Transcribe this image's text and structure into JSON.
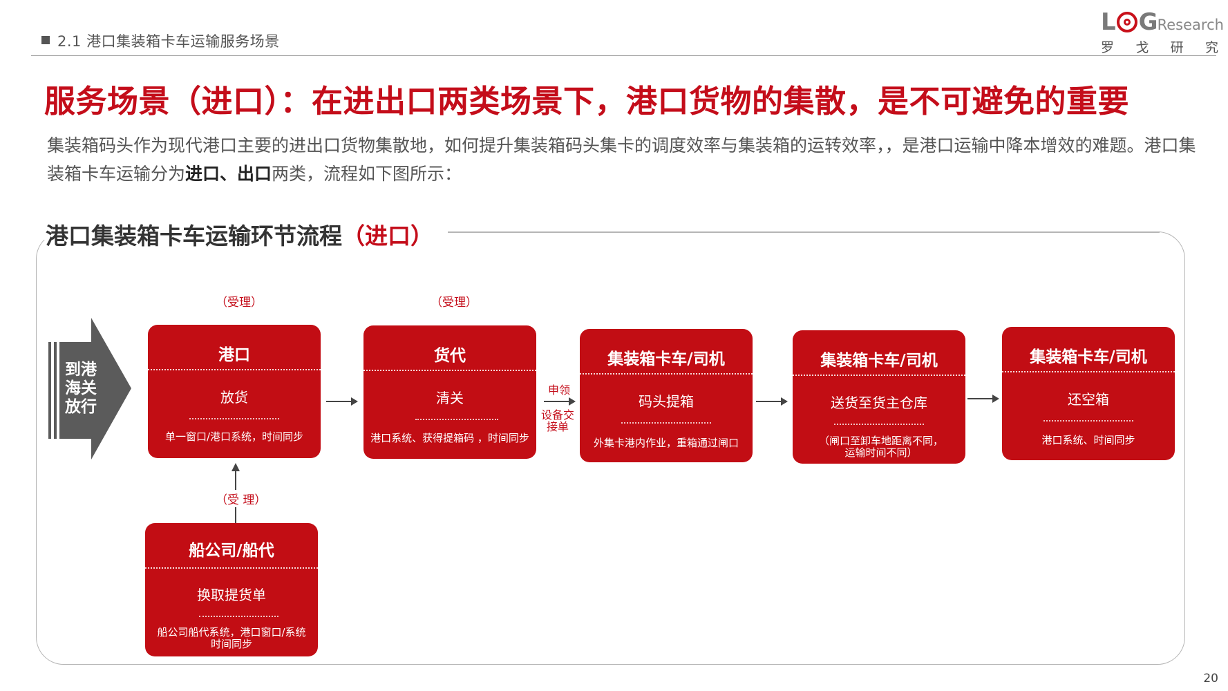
{
  "header": {
    "section": "2.1 港口集装箱卡车运输服务场景",
    "logo": {
      "brand_l": "L",
      "brand_g": "G",
      "brand_rest": "Research",
      "sub": [
        "罗",
        "戈",
        "研",
        "究"
      ]
    }
  },
  "title": "服务场景（进口）：在进出口两类场景下，港口货物的集散，是不可避免的重要",
  "intro": {
    "text1": "集装箱码头作为现代港口主要的进出口货物集散地，如何提升集装箱码头集卡的调度效率与集装箱的运转效率，，是港口运输中降本增效的难题。港口集装箱卡车运输分为",
    "bold": "进口、出口",
    "text2": "两类，流程如下图所示："
  },
  "section_title": {
    "main": "港口集装箱卡车运输环节流程",
    "highlight": "（进口）"
  },
  "flow": {
    "start": {
      "label": "到港海关放行"
    },
    "accept_labels": [
      "（受理）",
      "（受理）",
      "（受 理）"
    ],
    "apply_label": "申领",
    "exchange_label": "设备交接单",
    "boxes": [
      {
        "title": "港口",
        "action": "放货",
        "system": "单一窗口/港口系统，时间同步"
      },
      {
        "title": "货代",
        "action": "清关",
        "system": "港口系统、获得提箱码 ，时间同步"
      },
      {
        "title": "集装箱卡车/司机",
        "action": "码头提箱",
        "system": "外集卡港内作业，重箱通过闸口"
      },
      {
        "title": "集装箱卡车/司机",
        "action": "送货至货主仓库",
        "system": "（闸口至卸车地距离不同，运输时间不同）"
      },
      {
        "title": "集装箱卡车/司机",
        "action": "还空箱",
        "system": "港口系统、时间同步"
      },
      {
        "title": "船公司/船代",
        "action": "换取提货单",
        "system": "船公司船代系统，港口窗口/系统时间同步"
      }
    ]
  },
  "page_number": "20",
  "colors": {
    "accent": "#c40d1a",
    "box": "#c20d14",
    "arrow": "#5b5b5b"
  }
}
